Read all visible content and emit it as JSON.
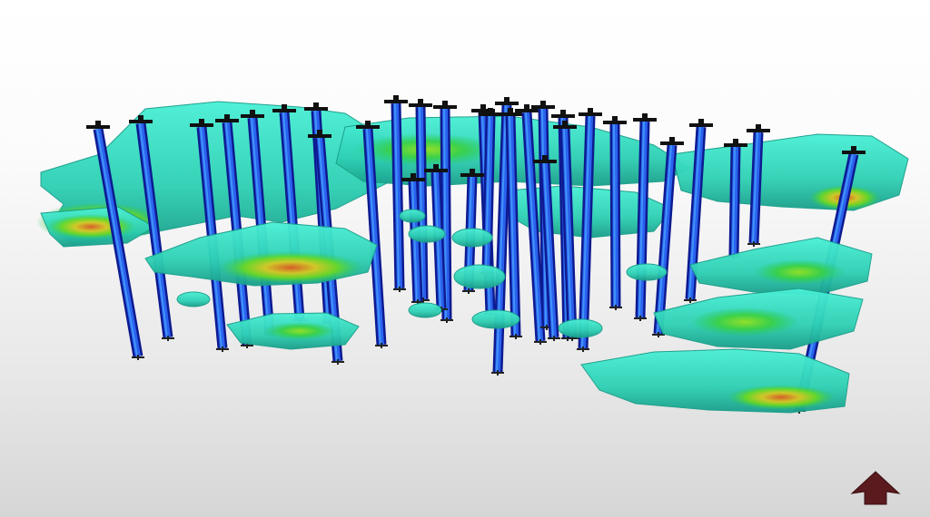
{
  "viewer": {
    "background_top": "#ffffff",
    "background_bottom": "#d6d6d6"
  },
  "colors": {
    "well_dark": "#1020a8",
    "well_mid": "#1d4fe0",
    "well_light": "#2f8cff",
    "collar": "#111111",
    "surface_base": "#2fd6b8",
    "surface_light": "#45f0d4",
    "surface_shadow": "#1aa894",
    "grade_low": "#23c860",
    "grade_mid": "#6ad81e",
    "grade_high": "#e0c81a",
    "grade_peak": "#e8541a",
    "orient_arrow": "#5a1a1e"
  },
  "icons": {
    "orientation": "up-arrow-icon"
  }
}
